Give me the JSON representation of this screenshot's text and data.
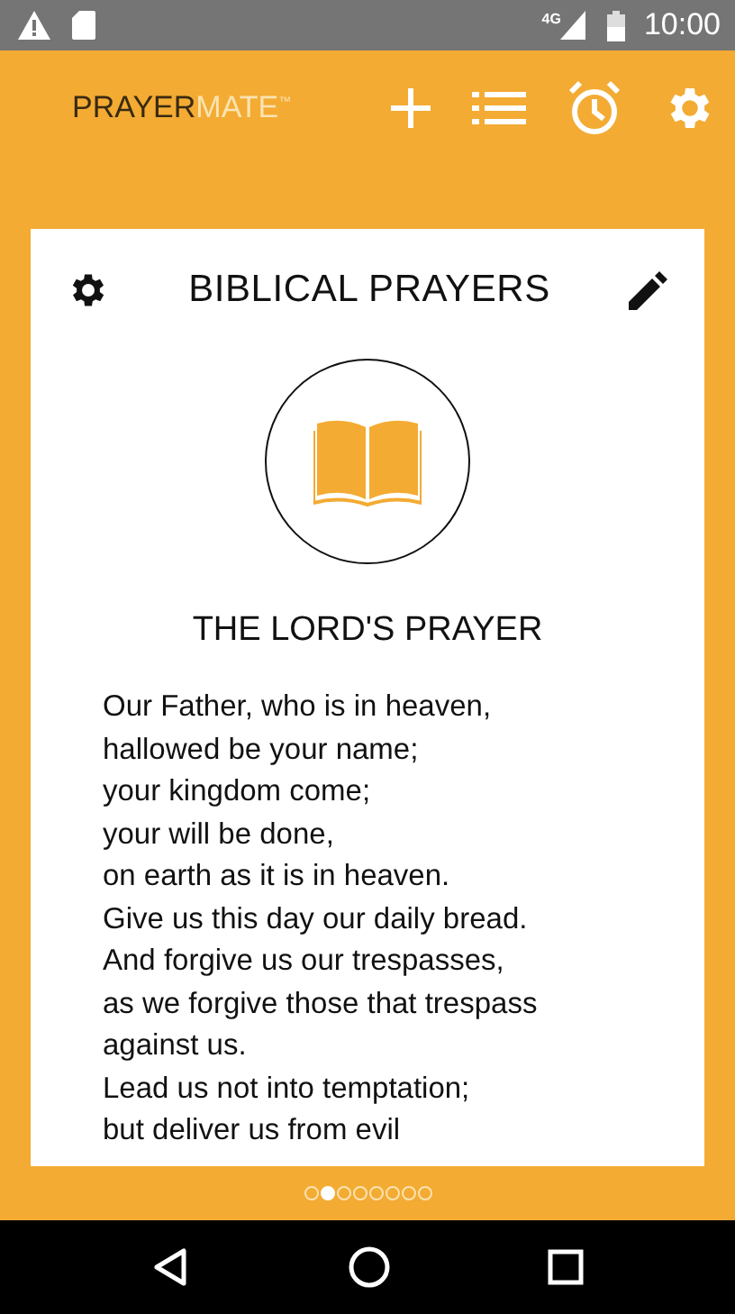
{
  "status_bar": {
    "time": "10:00",
    "network": "4G"
  },
  "app_bar": {
    "logo_dark": "PRAYER",
    "logo_light": "MATE",
    "logo_mark": "™"
  },
  "card": {
    "title": "BIBLICAL PRAYERS",
    "prayer_title": "THE LORD'S PRAYER",
    "lines": [
      "Our Father, who is in heaven,",
      "hallowed be your name;",
      "your kingdom come;",
      "your will be done,",
      "on earth as it is in heaven.",
      "Give us this day our daily bread.",
      "And forgive us our trespasses,",
      "as we forgive those that trespass",
      "against us.",
      "Lead us not into temptation;",
      "but deliver us from evil"
    ]
  },
  "pages": [
    {
      "selected": false
    },
    {
      "selected": true
    },
    {
      "selected": false
    },
    {
      "selected": false
    },
    {
      "selected": false
    },
    {
      "selected": false
    },
    {
      "selected": false
    },
    {
      "selected": false
    }
  ]
}
